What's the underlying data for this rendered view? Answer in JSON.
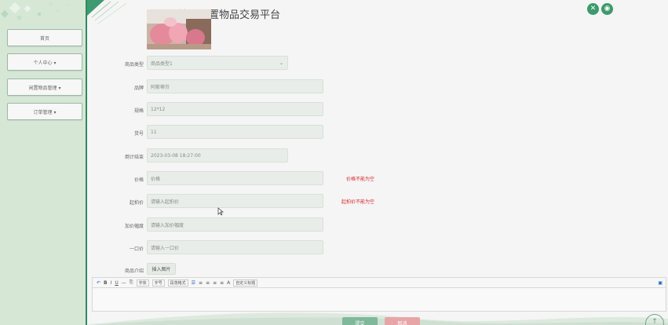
{
  "header": {
    "title": "校园闲置物品交易平台"
  },
  "top_icons": [
    {
      "name": "close-icon",
      "glyph": "✕"
    },
    {
      "name": "user-icon",
      "glyph": "◉"
    }
  ],
  "sidebar": {
    "items": [
      {
        "label": "首页"
      },
      {
        "label": "个人中心 ▾"
      },
      {
        "label": "闲置物品管理 ▾"
      },
      {
        "label": "订单管理 ▾"
      }
    ]
  },
  "form": {
    "category": {
      "label": "商品类型",
      "value": "商品类型1"
    },
    "brand": {
      "label": "品牌",
      "value": "阿斯蒂芬"
    },
    "spec": {
      "label": "规格",
      "value": "12*12"
    },
    "number": {
      "label": "货号",
      "value": "11"
    },
    "end_time": {
      "label": "倒计结束",
      "value": "2023-03-08 18:27:00"
    },
    "price": {
      "label": "价格",
      "placeholder": "价格",
      "error": "价格不能为空"
    },
    "start_price": {
      "label": "起拍价",
      "placeholder": "请输入起拍价",
      "error": "起拍价不能为空"
    },
    "increment": {
      "label": "加价幅度",
      "placeholder": "请输入加价幅度"
    },
    "buy_now": {
      "label": "一口价",
      "placeholder": "请输入一口价"
    },
    "intro": {
      "label": "商品介绍",
      "insert_image": "插入图片"
    }
  },
  "editor_toolbar": {
    "items": [
      "↶",
      "B",
      "I",
      "U",
      "—",
      "⎘"
    ],
    "font_family": "字体",
    "font_size": "字号",
    "paragraph": "段落格式",
    "align": [
      "☰",
      "≡",
      "≡",
      "≡",
      "≡"
    ],
    "text_color": "A",
    "custom_title": "自定义标题"
  },
  "actions": {
    "submit": "提交",
    "cancel": "取消"
  },
  "colors": {
    "accent": "#2f8a63",
    "sidebar_bg": "#d6e7d6",
    "error": "#d9262f",
    "submit_btn": "#7fb89a",
    "cancel_btn": "#e8a5a8"
  }
}
